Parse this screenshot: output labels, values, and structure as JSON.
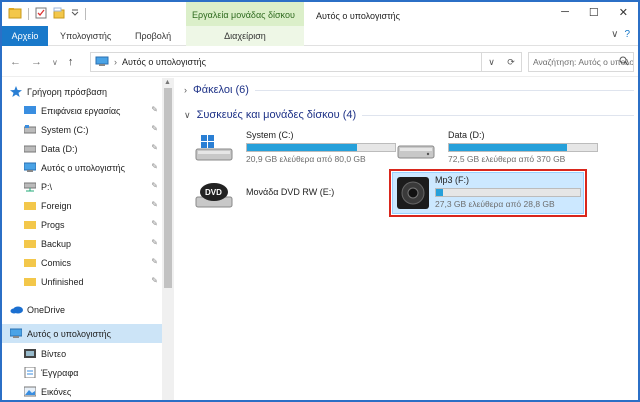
{
  "window": {
    "title": "Αυτός ο υπολογιστής"
  },
  "title_bar": {
    "contextual_tools_label": "Εργαλεία μονάδας δίσκου",
    "qat_separator": "|",
    "controls": {
      "minimize": "─",
      "maximize": "☐",
      "close": "✕"
    }
  },
  "ribbon": {
    "tabs": [
      {
        "label": "Αρχείο"
      },
      {
        "label": "Υπολογιστής"
      },
      {
        "label": "Προβολή"
      },
      {
        "label": "Διαχείριση"
      }
    ],
    "expand_glyph": "∨",
    "help_glyph": "?"
  },
  "address": {
    "nav": {
      "back": "←",
      "forward": "→",
      "dropdown": "∨",
      "up": "↑"
    },
    "path": "Αυτός ο υπολογιστής",
    "dropdown_glyph": "∨",
    "refresh_glyph": "⟳",
    "search_placeholder": "Αναζήτηση: Αυτός ο υπολογιστής"
  },
  "nav_pane": {
    "items": [
      {
        "label": "Γρήγορη πρόσβαση",
        "icon": "star-icon",
        "pinned": false
      },
      {
        "label": "Επιφάνεια εργασίας",
        "icon": "desktop-icon",
        "pinned": true
      },
      {
        "label": "System (C:)",
        "icon": "drive-icon",
        "pinned": true
      },
      {
        "label": "Data (D:)",
        "icon": "drive-icon",
        "pinned": true
      },
      {
        "label": "Αυτός ο υπολογιστής",
        "icon": "computer-icon",
        "pinned": true
      },
      {
        "label": "P:\\",
        "icon": "network-drive-icon",
        "pinned": true
      },
      {
        "label": "Foreign",
        "icon": "folder-icon",
        "pinned": true
      },
      {
        "label": "Progs",
        "icon": "folder-icon",
        "pinned": true
      },
      {
        "label": "Backup",
        "icon": "folder-icon",
        "pinned": true
      },
      {
        "label": "Comics",
        "icon": "folder-icon",
        "pinned": true
      },
      {
        "label": "Unfinished",
        "icon": "folder-icon",
        "pinned": true
      },
      {
        "label": "OneDrive",
        "icon": "cloud-icon",
        "pinned": false
      },
      {
        "label": "Αυτός ο υπολογιστής",
        "icon": "computer-icon",
        "pinned": false,
        "selected": true
      },
      {
        "label": "Βίντεο",
        "icon": "video-icon",
        "pinned": false
      },
      {
        "label": "Έγγραφα",
        "icon": "documents-icon",
        "pinned": false
      },
      {
        "label": "Εικόνες",
        "icon": "pictures-icon",
        "pinned": false
      }
    ],
    "pin_glyph": "📌",
    "scroll_up_glyph": "▲"
  },
  "content": {
    "groups": {
      "folders": {
        "label": "Φάκελοι (6)",
        "expanded": false,
        "chevron": "›"
      },
      "devices": {
        "label": "Συσκευές και μονάδες δίσκου (4)",
        "expanded": true,
        "chevron": "∨"
      }
    },
    "drives": [
      {
        "name": "System (C:)",
        "free_text": "20,9 GB ελεύθερα από 80,0 GB",
        "used_fraction": 0.74,
        "icon": "windows-drive-icon"
      },
      {
        "name": "Data (D:)",
        "free_text": "72,5 GB ελεύθερα από 370 GB",
        "used_fraction": 0.8,
        "icon": "drive-icon"
      },
      {
        "name": "Μονάδα DVD RW (E:)",
        "icon": "dvd-drive-icon",
        "label_on_icon": "DVD"
      },
      {
        "name": "Mp3 (F:)",
        "free_text": "27,3 GB ελεύθερα από 28,8 GB",
        "used_fraction": 0.05,
        "icon": "speaker-drive-icon",
        "selected": true
      }
    ]
  },
  "colors": {
    "accent": "#1979ca",
    "tools_tab_bg": "#dbefc9",
    "progress_fill": "#26a0da",
    "highlight": "#d9261c",
    "selection": "#cce8ff"
  }
}
